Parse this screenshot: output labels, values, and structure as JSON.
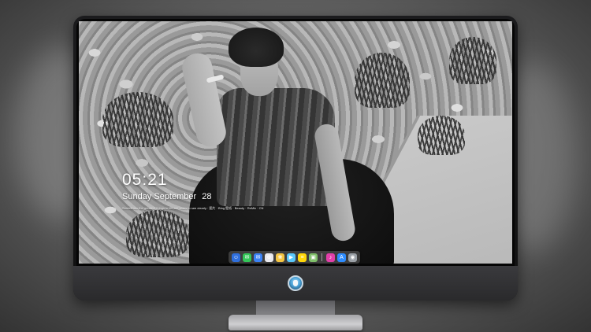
{
  "lockscreen": {
    "time": "05:21",
    "weekday_month": "Sunday September",
    "day": "28",
    "quote": "Sometimes the greatest things in life are yours to see clearly · 图片 · Bing 壁纸 · Beauty · ReMix · CN"
  },
  "dock": {
    "items": [
      {
        "name": "finder",
        "icon": "finder-icon",
        "color": "#2f6fdc",
        "glyph": "☺"
      },
      {
        "name": "messages",
        "icon": "messages-icon",
        "color": "#34c759",
        "glyph": "✉"
      },
      {
        "name": "mail",
        "icon": "mail-icon",
        "color": "#3b82f6",
        "glyph": "✉"
      },
      {
        "name": "safari",
        "icon": "safari-icon",
        "color": "#e9e9ee",
        "glyph": "⊕"
      },
      {
        "name": "photos",
        "icon": "photos-icon",
        "color": "#f4c542",
        "glyph": "❀"
      },
      {
        "name": "finalcut",
        "icon": "clapper-icon",
        "color": "#5ac8fa",
        "glyph": "▶"
      },
      {
        "name": "notes",
        "icon": "notes-icon",
        "color": "#ffd60a",
        "glyph": "≡"
      },
      {
        "name": "preview",
        "icon": "preview-icon",
        "color": "#7fbf6a",
        "glyph": "▣"
      },
      {
        "name": "itunes",
        "icon": "music-icon",
        "color": "#e23fa9",
        "glyph": "♪"
      },
      {
        "name": "appstore",
        "icon": "appstore-icon",
        "color": "#2d8cff",
        "glyph": "A"
      },
      {
        "name": "camera",
        "icon": "camera-icon",
        "color": "#9aa0a6",
        "glyph": "◉"
      }
    ]
  }
}
